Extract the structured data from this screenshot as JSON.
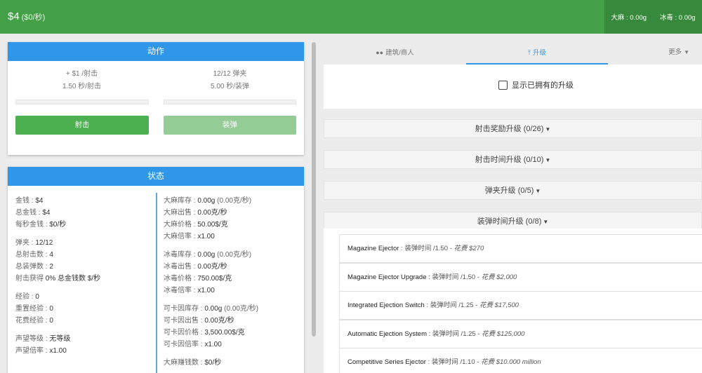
{
  "header": {
    "money": "$4",
    "rate": "($0/秒)",
    "weed": "大麻 : 0.00g",
    "meth": "冰毒 : 0.00g"
  },
  "action": {
    "title": "动作",
    "shoot_reward": "+ $1 /射击",
    "shoot_time": "1.50 秒/射击",
    "mag": "12/12 弹夹",
    "reload_time": "5.00 秒/装弹",
    "shoot_label": "射击",
    "reload_label": "装弹",
    "shoot_progress": 0,
    "reload_progress": 0
  },
  "status": {
    "title": "状态",
    "left": [
      [
        {
          "k": "金钱 : ",
          "v": "$4"
        },
        {
          "k": "总金钱 : ",
          "v": "$4"
        },
        {
          "k": "每秒金钱 : ",
          "v": "$0/秒"
        }
      ],
      [
        {
          "k": "弹夹 : ",
          "v": "12/12"
        },
        {
          "k": "总射击数 : ",
          "v": "4"
        },
        {
          "k": "总装弹数 : ",
          "v": "2"
        },
        {
          "k": "射击获得 ",
          "v": "0% 总金钱数 $/秒"
        }
      ],
      [
        {
          "k": "经验 : ",
          "v": "0"
        },
        {
          "k": "重置经验 : ",
          "v": "0"
        },
        {
          "k": "花费经验 : ",
          "v": "0"
        }
      ],
      [
        {
          "k": "声望等级 : ",
          "v": "无等级"
        },
        {
          "k": "声望倍率 : ",
          "v": "x1.00"
        }
      ]
    ],
    "right": [
      [
        {
          "k": "大麻库存 : ",
          "v": "0.00g",
          "x": " (0.00克/秒)"
        },
        {
          "k": "大麻出售 : ",
          "v": "0.00克/秒"
        },
        {
          "k": "大麻价格 : ",
          "v": "50.00$/克"
        },
        {
          "k": "大麻倍率 : ",
          "v": "x1.00"
        }
      ],
      [
        {
          "k": "冰毒库存 : ",
          "v": "0.00g",
          "x": " (0.00克/秒)"
        },
        {
          "k": "冰毒出售 : ",
          "v": "0.00克/秒"
        },
        {
          "k": "冰毒价格 : ",
          "v": "750.00$/克"
        },
        {
          "k": "冰毒倍率 : ",
          "v": "x1.00"
        }
      ],
      [
        {
          "k": "可卡因库存 : ",
          "v": "0.00g",
          "x": " (0.00克/秒)"
        },
        {
          "k": "可卡因出售 : ",
          "v": "0.00克/秒"
        },
        {
          "k": "可卡因价格 : ",
          "v": "3,500.00$/克"
        },
        {
          "k": "可卡因倍率 : ",
          "v": "x1.00"
        }
      ],
      [
        {
          "k": "大麻赚钱数 : ",
          "v": "$0/秒"
        }
      ]
    ]
  },
  "tabs": {
    "buildings": "建筑/商人",
    "upgrades": "升级",
    "more": "更多"
  },
  "show_owned_label": "显示已拥有的升级",
  "categories": [
    "射击奖励升级 (0/26)",
    "射击时间升级 (0/10)",
    "弹夹升级 (0/5)",
    "装弹时间升级 (0/8)"
  ],
  "upgrades": [
    {
      "name": "Magazine Ejector",
      "effect": " : 装弹时间 /1.50 - ",
      "cost": "花费 $270"
    },
    {
      "name": "Magazine Ejector Upgrade",
      "effect": " : 装弹时间 /1.50 - ",
      "cost": "花费 $2,000"
    },
    {
      "name": "Integrated Ejection Switch",
      "effect": " : 装弹时间 /1.25 - ",
      "cost": "花费 $17,500"
    },
    {
      "name": "Automatic Ejection System",
      "effect": " : 装弹时间 /1.25 - ",
      "cost": "花费 $125,000"
    },
    {
      "name": "Competitive Series Ejector",
      "effect": " : 装弹时间 /1.10 - ",
      "cost": "花费 $10.000 million"
    }
  ],
  "colors": {
    "header_green": "#43a047",
    "panel_blue": "#2f96e8",
    "shoot_button": "#4caf50",
    "reload_button": "#93cd95"
  }
}
